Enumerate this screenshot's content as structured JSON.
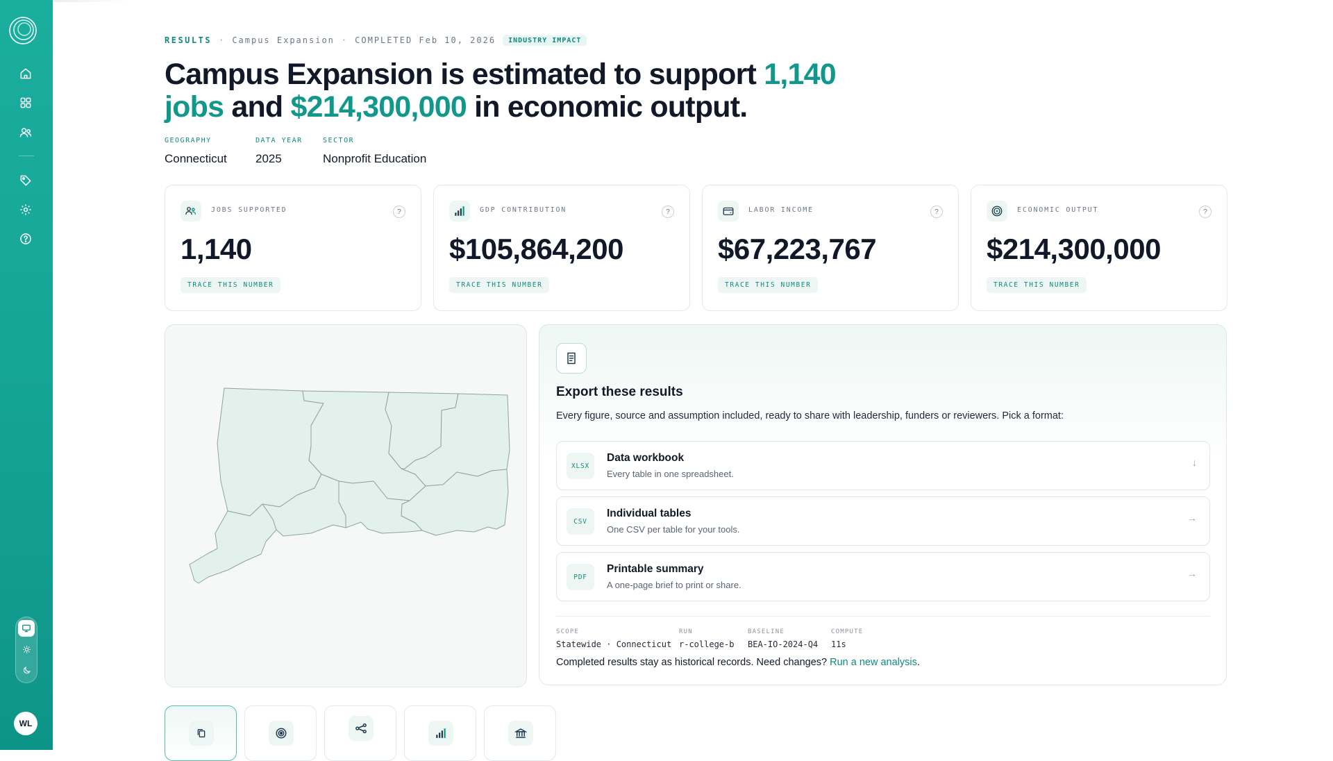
{
  "breadcrumb": {
    "section": "RESULTS",
    "project": "Campus Expansion",
    "status": "COMPLETED Feb 10, 2026",
    "badge": "INDUSTRY IMPACT"
  },
  "headline": {
    "part1": "Campus Expansion is estimated to support ",
    "jobs": "1,140 jobs",
    "part2": " and ",
    "output": "$214,300,000",
    "part3": " in economic output."
  },
  "meta": [
    {
      "label": "GEOGRAPHY",
      "value": "Connecticut"
    },
    {
      "label": "DATA YEAR",
      "value": "2025"
    },
    {
      "label": "SECTOR",
      "value": "Nonprofit Education"
    }
  ],
  "cards": [
    {
      "label": "JOBS SUPPORTED",
      "value": "1,140",
      "icon": "users-icon"
    },
    {
      "label": "GDP CONTRIBUTION",
      "value": "$105,864,200",
      "icon": "bar-chart-icon"
    },
    {
      "label": "LABOR INCOME",
      "value": "$67,223,767",
      "icon": "wallet-icon"
    },
    {
      "label": "ECONOMIC OUTPUT",
      "value": "$214,300,000",
      "icon": "target-icon"
    }
  ],
  "card_help": "?",
  "trace_label": "TRACE THIS NUMBER",
  "export": {
    "title": "Export these results",
    "description": "Every figure, source and assumption included, ready to share with leadership, funders or reviewers. Pick a format:",
    "options": [
      {
        "format": "XLSX",
        "title": "Data workbook",
        "subtitle": "Every table in one spreadsheet.",
        "arrow": "↓"
      },
      {
        "format": "CSV",
        "title": "Individual tables",
        "subtitle": "One CSV per table for your tools.",
        "arrow": "→"
      },
      {
        "format": "PDF",
        "title": "Printable summary",
        "subtitle": "A one-page brief to print or share.",
        "arrow": "→"
      }
    ],
    "meta": [
      {
        "key": "SCOPE",
        "value": "Statewide · Connecticut"
      },
      {
        "key": "RUN",
        "value": "r-college-b"
      },
      {
        "key": "BASELINE",
        "value": "BEA-IO-2024-Q4"
      },
      {
        "key": "COMPUTE",
        "value": "11s"
      }
    ],
    "note": "Completed results stay as historical records. Need changes? ",
    "note_link": "Run a new analysis",
    "note_end": "."
  },
  "user": {
    "initials": "WL"
  },
  "colors": {
    "accent": "#12988a",
    "sidebar": "#15a595",
    "map_fill": "#e3f1ec",
    "map_stroke": "#8fa39c"
  },
  "nav_icons": [
    "home-icon",
    "grid-icon",
    "users-icon",
    "tag-icon",
    "gear-icon",
    "help-icon"
  ],
  "bottom_tabs": [
    "copy-icon",
    "target-icon",
    "network-icon",
    "bar-chart-icon",
    "bank-icon"
  ]
}
